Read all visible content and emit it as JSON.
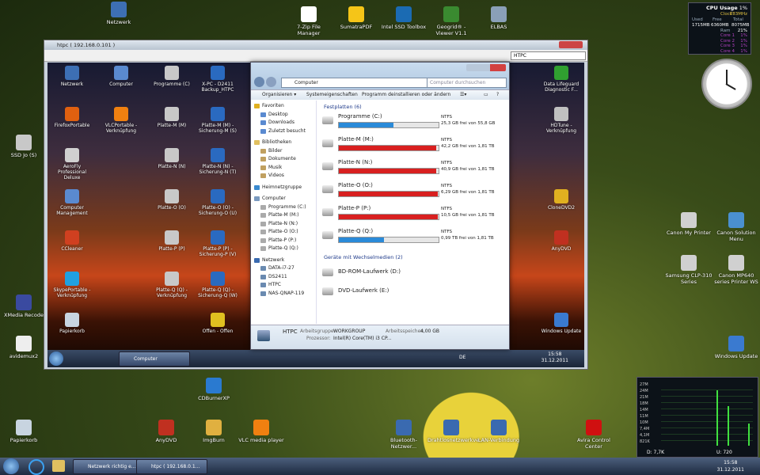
{
  "desktop_icons": [
    {
      "label": "Netzwerk",
      "name": "network-icon",
      "color": "#3d6fb4"
    },
    {
      "label": "7-Zip File Manager",
      "name": "seven-zip-icon",
      "color": "#ffffff"
    },
    {
      "label": "SumatraPDF",
      "name": "sumatra-pdf-icon",
      "color": "#f5c518"
    },
    {
      "label": "Intel SSD Toolbox",
      "name": "intel-ssd-icon",
      "color": "#1b6bb3"
    },
    {
      "label": "Geogrid® - Viewer V1.1",
      "name": "geogrid-icon",
      "color": "#3a8a30"
    },
    {
      "label": "ELBAS",
      "name": "elbas-icon",
      "color": "#8aa0b8"
    },
    {
      "label": "SSD Jo (S)",
      "name": "ssd-drive-icon",
      "color": "#c8c8c8"
    },
    {
      "label": "XMedia Recode",
      "name": "xmedia-recode-icon",
      "color": "#3a4aa0"
    },
    {
      "label": "avidemux2",
      "name": "avidemux-icon",
      "color": "#eeeeee"
    },
    {
      "label": "Papierkorb",
      "name": "recycle-bin-icon",
      "color": "#c8d4e0"
    },
    {
      "label": "CDBurnerXP",
      "name": "cdburner-icon",
      "color": "#2a7ad0"
    },
    {
      "label": "AnyDVD",
      "name": "anydvd-icon",
      "color": "#c03020"
    },
    {
      "label": "ImgBurn",
      "name": "imgburn-icon",
      "color": "#e0b040"
    },
    {
      "label": "VLC media player",
      "name": "vlc-icon",
      "color": "#f08010"
    },
    {
      "label": "Bluetooth-Netzwer...",
      "name": "bluetooth-network-icon",
      "color": "#3a6ab0"
    },
    {
      "label": "Drahtlosnetzwerkve...",
      "name": "wireless-network-icon",
      "color": "#3a6ab0"
    },
    {
      "label": "LAN-Verbindung",
      "name": "lan-connection-icon",
      "color": "#3a6ab0"
    },
    {
      "label": "Avira Control Center",
      "name": "avira-icon",
      "color": "#d01010"
    },
    {
      "label": "Canon My Printer",
      "name": "canon-printer-icon",
      "color": "#d0d0d0"
    },
    {
      "label": "Canon Solution Menu",
      "name": "canon-solution-icon",
      "color": "#4a90d0"
    },
    {
      "label": "Samsung CLP-310 Series",
      "name": "samsung-printer-icon",
      "color": "#d0d0d0"
    },
    {
      "label": "Canon MP640 series Printer WS",
      "name": "canon-mp640-icon",
      "color": "#d0d0d0"
    },
    {
      "label": "Windows Update",
      "name": "windows-update-icon",
      "color": "#3a7ad0"
    }
  ],
  "remote_window": {
    "title": "htpc ( 192.168.0.101 )",
    "ip_field": "HTPC"
  },
  "remote_icons": [
    {
      "label": "Netzwerk",
      "name": "network-icon",
      "color": "#3d6fb4"
    },
    {
      "label": "Computer",
      "name": "computer-icon",
      "color": "#5a8ad0"
    },
    {
      "label": "Programme (C)",
      "name": "drive-c-icon",
      "color": "#c8c8c8"
    },
    {
      "label": "X-PC - D2411 Backup_HTPC",
      "name": "backup-htpc-icon",
      "color": "#2a6ac0"
    },
    {
      "label": "FirefoxPortable",
      "name": "firefox-icon",
      "color": "#e06010"
    },
    {
      "label": "VLCPortable - Verknüpfung",
      "name": "vlc-portable-icon",
      "color": "#f08010"
    },
    {
      "label": "Platte-M (M)",
      "name": "drive-m-icon",
      "color": "#c8c8c8"
    },
    {
      "label": "Platte-M (M) - Sicherung-M (S)",
      "name": "backup-m-icon",
      "color": "#2a6ac0"
    },
    {
      "label": "AeroFly Professional Deluxe",
      "name": "aerofly-icon",
      "color": "#d0d0d0"
    },
    {
      "label": "Platte-N (N)",
      "name": "drive-n-icon",
      "color": "#c8c8c8"
    },
    {
      "label": "Platte-N (N) - Sicherung-N (T)",
      "name": "backup-n-icon",
      "color": "#2a6ac0"
    },
    {
      "label": "Computer Management",
      "name": "computer-management-icon",
      "color": "#5a8ad0"
    },
    {
      "label": "Platte-O (O)",
      "name": "drive-o-icon",
      "color": "#c8c8c8"
    },
    {
      "label": "Platte-O (O) - Sicherung-O (U)",
      "name": "backup-o-icon",
      "color": "#2a6ac0"
    },
    {
      "label": "CCleaner",
      "name": "ccleaner-icon",
      "color": "#d04020"
    },
    {
      "label": "Platte-P (P)",
      "name": "drive-p-icon",
      "color": "#c8c8c8"
    },
    {
      "label": "Platte-P (P) - Sicherung-P (V)",
      "name": "backup-p-icon",
      "color": "#2a6ac0"
    },
    {
      "label": "SkypePortable - Verknüpfung",
      "name": "skype-icon",
      "color": "#20a0e0"
    },
    {
      "label": "Platte-Q (Q) - Verknüpfung",
      "name": "drive-q-icon",
      "color": "#c8c8c8"
    },
    {
      "label": "Platte-Q (Q) - Sicherung-Q (W)",
      "name": "backup-q-icon",
      "color": "#2a6ac0"
    },
    {
      "label": "Papierkorb",
      "name": "recycle-bin-icon",
      "color": "#c8d4e0"
    },
    {
      "label": "Offen - Offen",
      "name": "offen-icon",
      "color": "#e0c020"
    },
    {
      "label": "Data Lifeguard Diagnostic F...",
      "name": "lifeguard-icon",
      "color": "#30a030"
    },
    {
      "label": "HDTune - Verknüpfung",
      "name": "hdtune-icon",
      "color": "#c0c0c0"
    },
    {
      "label": "CloneDVD2",
      "name": "clonedvd-icon",
      "color": "#e0b020"
    },
    {
      "label": "AnyDVD",
      "name": "anydvd-icon",
      "color": "#c03020"
    },
    {
      "label": "Windows Update",
      "name": "windows-update-icon",
      "color": "#3a7ad0"
    }
  ],
  "explorer": {
    "address": "Computer",
    "search_placeholder": "Computer durchsuchen",
    "commands": [
      "Organisieren ▾",
      "Systemeigenschaften",
      "Programm deinstallieren oder ändern"
    ],
    "nav": {
      "favorites": "Favoriten",
      "fav_items": [
        "Desktop",
        "Downloads",
        "Zuletzt besucht"
      ],
      "libraries": "Bibliotheken",
      "lib_items": [
        "Bilder",
        "Dokumente",
        "Musik",
        "Videos"
      ],
      "homegroup": "Heimnetzgruppe",
      "computer": "Computer",
      "comp_items": [
        "Programme (C:)",
        "Platte-M (M:)",
        "Platte-N (N:)",
        "Platte-O (O:)",
        "Platte-P (P:)",
        "Platte-Q (Q:)"
      ],
      "network": "Netzwerk",
      "net_items": [
        "DATA-i7-27",
        "DS2411",
        "HTPC",
        "NAS-QNAP-119"
      ]
    },
    "section_hdd": "Festplatten (6)",
    "drives": [
      {
        "name": "Programme (C:)",
        "fs": "NTFS",
        "free": "25,3 GB frei von 55,8 GB",
        "used": 0.55,
        "color": "#2a8ad8"
      },
      {
        "name": "Platte-M (M:)",
        "fs": "NTFS",
        "free": "42,2 GB frei von 1,81 TB",
        "used": 0.98,
        "color": "#d82020"
      },
      {
        "name": "Platte-N (N:)",
        "fs": "NTFS",
        "free": "40,9 GB frei von 1,81 TB",
        "used": 0.98,
        "color": "#d82020"
      },
      {
        "name": "Platte-O (O:)",
        "fs": "NTFS",
        "free": "6,29 GB frei von 1,81 TB",
        "used": 0.99,
        "color": "#d82020"
      },
      {
        "name": "Platte-P (P:)",
        "fs": "NTFS",
        "free": "10,5 GB frei von 1,81 TB",
        "used": 0.99,
        "color": "#d82020"
      },
      {
        "name": "Platte-Q (Q:)",
        "fs": "NTFS",
        "free": "0,99 TB frei von 1,81 TB",
        "used": 0.45,
        "color": "#2a8ad8"
      }
    ],
    "section_removable": "Geräte mit Wechselmedien (2)",
    "removable": [
      "BD-ROM-Laufwerk (D:)",
      "DVD-Laufwerk (E:)"
    ],
    "status": {
      "name": "HTPC",
      "wg_label": "Arbeitsgruppe:",
      "wg": "WORKGROUP",
      "mem_label": "Arbeitsspeicher:",
      "mem": "4,00 GB",
      "cpu_label": "Prozessor:",
      "cpu": "Intel(R) Core(TM) i3 CP..."
    }
  },
  "remote_taskbar": {
    "button": "Computer",
    "lang": "DE",
    "time": "15:58",
    "date": "31.12.2011"
  },
  "taskbar": {
    "buttons": [
      "Netzwerk richtig e...",
      "htpc ( 192.168.0.1..."
    ],
    "time": "15:58",
    "date": "31.12.2011"
  },
  "cpu_gadget": {
    "title": "CPU Usage",
    "percent": "1%",
    "clock_label": "Clock",
    "clock": "783MHz",
    "headers": [
      "Used",
      "Free",
      "Total"
    ],
    "ram_label": "Ram",
    "ram_pct": "21%",
    "values": [
      "1715MB",
      "6360MB",
      "8075MB"
    ],
    "cores": [
      {
        "label": "Core 1",
        "pct": "1%"
      },
      {
        "label": "Core 2",
        "pct": "1%"
      },
      {
        "label": "Core 3",
        "pct": "1%"
      },
      {
        "label": "Core 4",
        "pct": "1%"
      }
    ]
  },
  "net_gadget": {
    "scale": [
      "27M",
      "24M",
      "21M",
      "18M",
      "14M",
      "11M",
      "10M",
      "7,4M",
      "4,1M",
      "821K"
    ],
    "down_label": "D: 7,7K",
    "up_label": "U: 720"
  }
}
